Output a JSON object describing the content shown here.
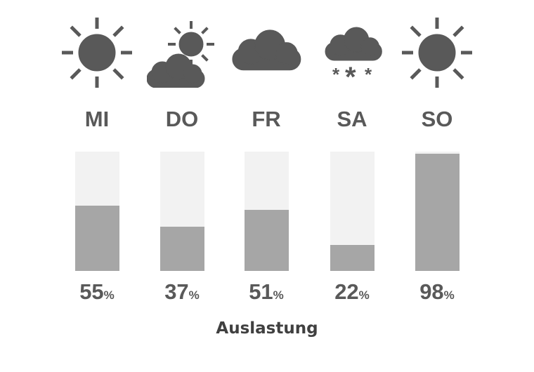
{
  "chart_data": {
    "type": "bar",
    "categories": [
      "MI",
      "DO",
      "FR",
      "SA",
      "SO"
    ],
    "values": [
      55,
      37,
      51,
      22,
      98
    ],
    "value_unit": "%",
    "icons": [
      "sun-icon",
      "partly-cloudy-icon",
      "cloud-icon",
      "snow-icon",
      "sun-icon"
    ],
    "ylim": [
      0,
      100
    ],
    "xlabel": "Auslastung",
    "colors": {
      "fill": "#a6a6a6",
      "track": "#f2f2f2",
      "text": "#595959"
    }
  }
}
